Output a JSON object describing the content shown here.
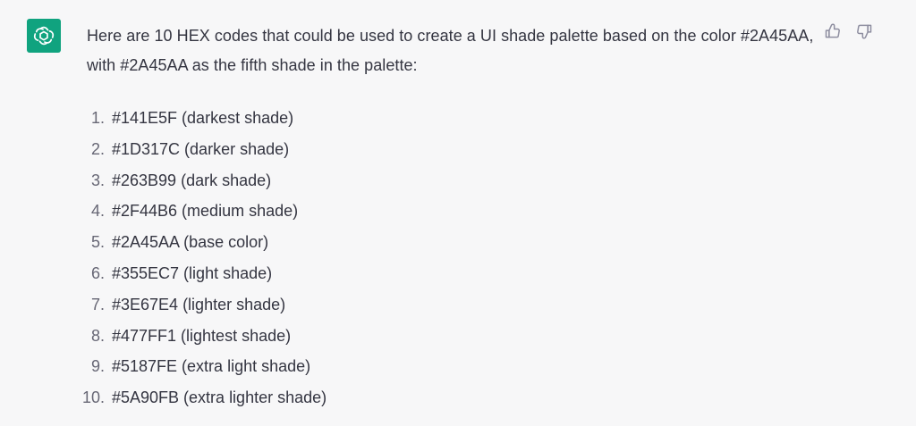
{
  "assistant": {
    "avatar_icon": "openai-logo-icon",
    "avatar_color": "#10A37F"
  },
  "message": {
    "intro": "Here are 10 HEX codes that could be used to create a UI shade palette based on the color #2A45AA, with #2A45AA as the fifth shade in the palette:",
    "items": [
      {
        "number": "1.",
        "text": "#141E5F (darkest shade)"
      },
      {
        "number": "2.",
        "text": "#1D317C (darker shade)"
      },
      {
        "number": "3.",
        "text": "#263B99 (dark shade)"
      },
      {
        "number": "4.",
        "text": "#2F44B6 (medium shade)"
      },
      {
        "number": "5.",
        "text": "#2A45AA (base color)"
      },
      {
        "number": "6.",
        "text": "#355EC7 (light shade)"
      },
      {
        "number": "7.",
        "text": "#3E67E4 (lighter shade)"
      },
      {
        "number": "8.",
        "text": "#477FF1 (lightest shade)"
      },
      {
        "number": "9.",
        "text": "#5187FE (extra light shade)"
      },
      {
        "number": "10.",
        "text": "#5A90FB (extra lighter shade)"
      }
    ]
  },
  "feedback": {
    "thumbs_up_icon": "thumbs-up-icon",
    "thumbs_down_icon": "thumbs-down-icon"
  },
  "colors": {
    "background": "#F7F7F8",
    "text": "#343541",
    "muted": "#676775"
  }
}
